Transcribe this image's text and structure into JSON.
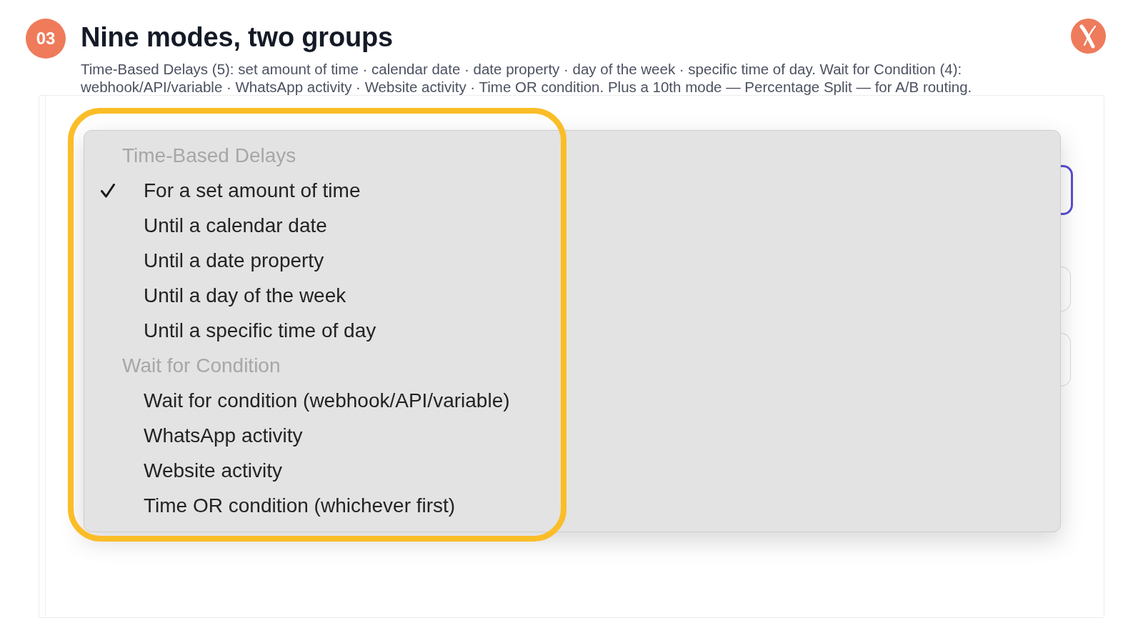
{
  "step": {
    "number": "03",
    "title": "Nine modes, two groups",
    "description": "Time-Based Delays (5): set amount of time · calendar date · date property · day of the week · specific time of day. Wait for Condition (4): webhook/API/variable · WhatsApp activity · Website activity · Time OR condition. Plus a 10th mode — Percentage Split — for A/B routing."
  },
  "form_fields": [
    {
      "focused": true
    },
    {
      "focused": false
    },
    {
      "focused": false
    }
  ],
  "dropdown": {
    "groups": [
      {
        "label": "Time-Based Delays",
        "options": [
          {
            "label": "For a set amount of time",
            "selected": true
          },
          {
            "label": "Until a calendar date",
            "selected": false
          },
          {
            "label": "Until a date property",
            "selected": false
          },
          {
            "label": "Until a day of the week",
            "selected": false
          },
          {
            "label": "Until a specific time of day",
            "selected": false
          }
        ]
      },
      {
        "label": "Wait for Condition",
        "options": [
          {
            "label": "Wait for condition (webhook/API/variable)",
            "selected": false
          },
          {
            "label": "WhatsApp activity",
            "selected": false
          },
          {
            "label": "Website activity",
            "selected": false
          },
          {
            "label": "Time OR condition (whichever first)",
            "selected": false
          }
        ]
      }
    ]
  }
}
